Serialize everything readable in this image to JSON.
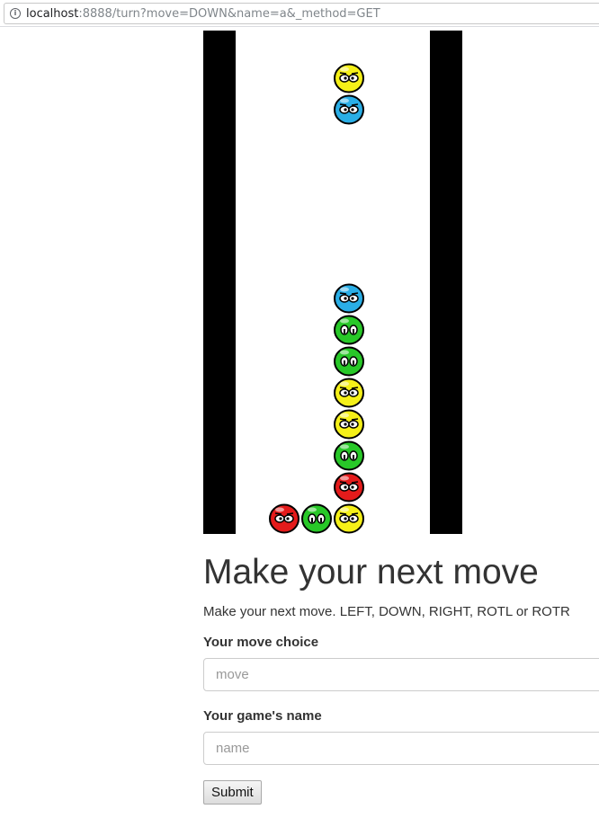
{
  "browser": {
    "url_host": "localhost",
    "url_rest": ":8888/turn?move=DOWN&name=a&_method=GET"
  },
  "game": {
    "columns": 6,
    "rows": 16,
    "colors": {
      "yellow": "#f5f018",
      "blue": "#2aaee6",
      "green": "#28c828",
      "red": "#e41b1b"
    },
    "pieces": [
      {
        "color": "yellow",
        "col": 3,
        "row": 1
      },
      {
        "color": "blue",
        "col": 3,
        "row": 2
      },
      {
        "color": "blue",
        "col": 3,
        "row": 8
      },
      {
        "color": "green",
        "col": 3,
        "row": 9
      },
      {
        "color": "green",
        "col": 3,
        "row": 10
      },
      {
        "color": "yellow",
        "col": 3,
        "row": 11
      },
      {
        "color": "yellow",
        "col": 3,
        "row": 12
      },
      {
        "color": "green",
        "col": 3,
        "row": 13
      },
      {
        "color": "red",
        "col": 3,
        "row": 14
      },
      {
        "color": "red",
        "col": 1,
        "row": 15
      },
      {
        "color": "green",
        "col": 2,
        "row": 15
      },
      {
        "color": "yellow",
        "col": 3,
        "row": 15
      }
    ]
  },
  "form": {
    "title": "Make your next move",
    "description": "Make your next move. LEFT, DOWN, RIGHT, ROTL or ROTR",
    "move_label": "Your move choice",
    "move_placeholder": "move",
    "name_label": "Your game's name",
    "name_placeholder": "name",
    "submit_label": "Submit"
  }
}
